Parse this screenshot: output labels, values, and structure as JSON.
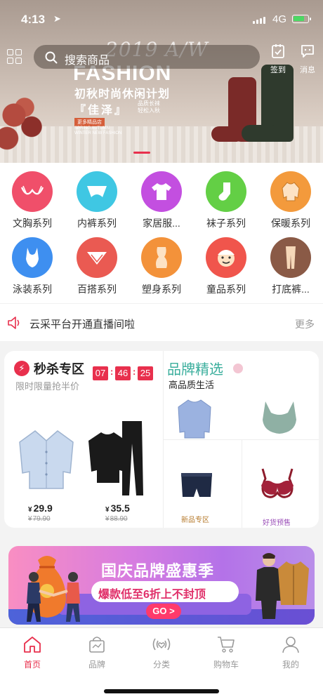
{
  "status_bar": {
    "time": "4:13",
    "network": "4G"
  },
  "banner": {
    "script_text": "2019 A/W",
    "headline": "FASHION",
    "subtitle": "初秋时尚休闲计划",
    "brand": "佳泽",
    "brand_side": "品质长袜 轻松入秋",
    "tag": "更多精品店",
    "tagline": "SPRING AUTUMN WINTER NEW FASHION"
  },
  "top_nav": {
    "search_placeholder": "搜索商品",
    "checkin_label": "签到",
    "message_label": "消息"
  },
  "categories": [
    {
      "label": "文胸系列",
      "color": "#f04f6a",
      "icon": "bra-icon"
    },
    {
      "label": "内裤系列",
      "color": "#3fc7e3",
      "icon": "underwear-icon"
    },
    {
      "label": "家居服...",
      "color": "#c34fe0",
      "icon": "loungewear-icon"
    },
    {
      "label": "袜子系列",
      "color": "#63cf45",
      "icon": "sock-icon"
    },
    {
      "label": "保暖系列",
      "color": "#f39a3c",
      "icon": "thermal-icon"
    },
    {
      "label": "泳装系列",
      "color": "#3e8ff0",
      "icon": "swimsuit-icon"
    },
    {
      "label": "百搭系列",
      "color": "#ea5a52",
      "icon": "versatile-icon"
    },
    {
      "label": "塑身系列",
      "color": "#f3923a",
      "icon": "shapewear-icon"
    },
    {
      "label": "童品系列",
      "color": "#f0554c",
      "icon": "kids-icon"
    },
    {
      "label": "打底裤...",
      "color": "#8a5a46",
      "icon": "leggings-icon"
    }
  ],
  "notice": {
    "text": "云采平台开通直播间啦",
    "more": "更多"
  },
  "flash_sale": {
    "title": "秒杀专区",
    "subtitle": "限时限量抢半价",
    "countdown": [
      "07",
      "46",
      "25"
    ],
    "products": [
      {
        "currency": "¥",
        "price": "29.9",
        "old_price": "79.90",
        "icon": "pajamas-icon"
      },
      {
        "currency": "¥",
        "price": "35.5",
        "old_price": "88.90",
        "icon": "thermal-set-icon"
      }
    ]
  },
  "brand_picks": {
    "title": "品牌精选",
    "subtitle": "高品质生活",
    "new_label": "新品专区",
    "presale_label": "好货预售"
  },
  "ad_banner": {
    "headline": "国庆品牌盛惠季",
    "offer": "爆款低至6折上不封顶",
    "cta": "GO >"
  },
  "tab_bar": [
    {
      "label": "首页",
      "icon": "home-icon",
      "active": true
    },
    {
      "label": "品牌",
      "icon": "brand-bag-icon",
      "active": false
    },
    {
      "label": "分类",
      "icon": "category-icon",
      "active": false
    },
    {
      "label": "购物车",
      "icon": "cart-icon",
      "active": false
    },
    {
      "label": "我的",
      "icon": "profile-icon",
      "active": false
    }
  ],
  "colors": {
    "accent": "#e8304d",
    "brand_green": "#3aae9c"
  }
}
